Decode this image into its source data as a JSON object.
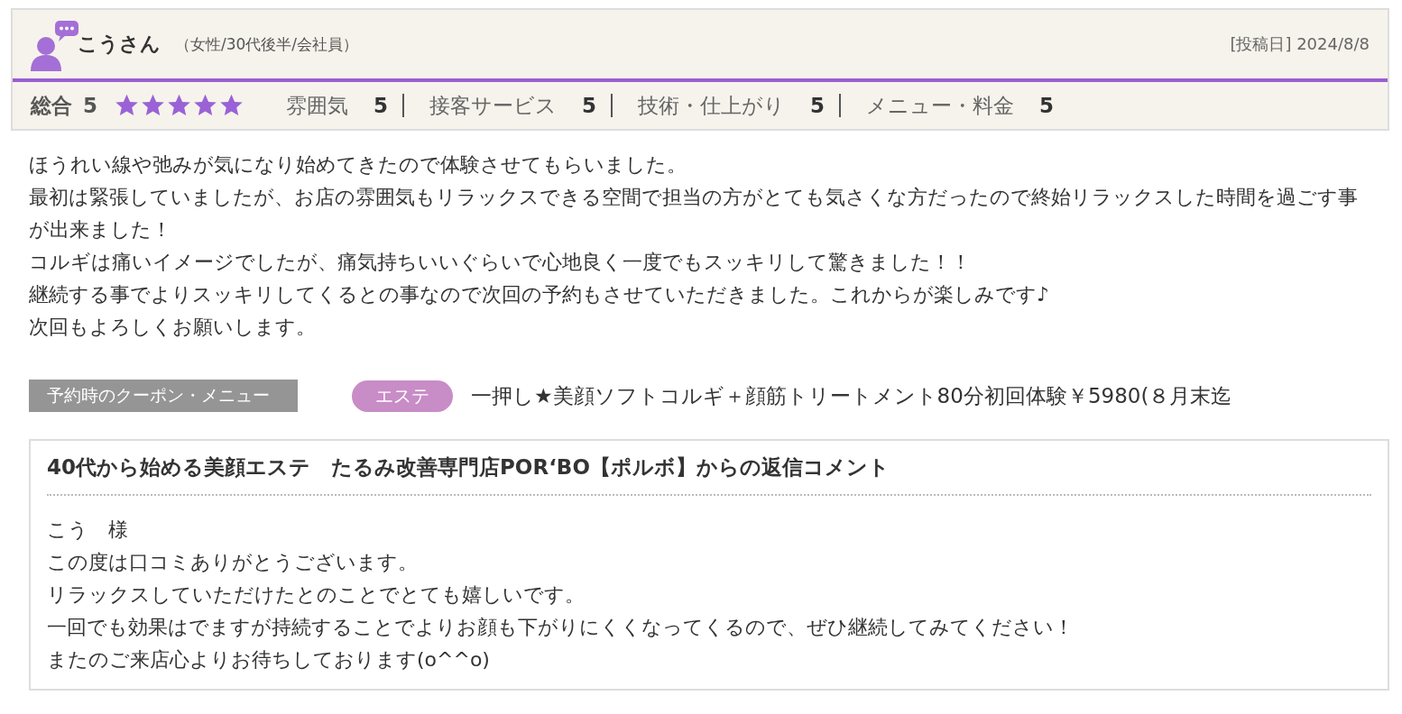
{
  "review": {
    "reviewer": "こうさん",
    "profile": "（女性/30代後半/会社員）",
    "posted": "[投稿日] 2024/8/8",
    "overall": {
      "label": "総合",
      "score": "5",
      "stars": 5
    },
    "categories": [
      {
        "label": "雰囲気",
        "score": "5"
      },
      {
        "label": "接客サービス",
        "score": "5"
      },
      {
        "label": "技術・仕上がり",
        "score": "5"
      },
      {
        "label": "メニュー・料金",
        "score": "5"
      }
    ],
    "body": [
      "ほうれい線や弛みが気になり始めてきたので体験させてもらいました。",
      "最初は緊張していましたが、お店の雰囲気もリラックスできる空間で担当の方がとても気さくな方だったので終始リラックスした時間を過ごす事が出来ました！",
      "コルギは痛いイメージでしたが、痛気持ちいいぐらいで心地良く一度でもスッキリして驚きました！！",
      "継続する事でよりスッキリしてくるとの事なので次回の予約もさせていただきました。これからが楽しみです♪",
      "次回もよろしくお願いします。"
    ],
    "coupon": {
      "label": "予約時のクーポン・メニュー",
      "tag": "エステ",
      "name": "一押し★美顔ソフトコルギ＋顔筋トリートメント80分初回体験￥5980(８月末迄"
    }
  },
  "reply": {
    "title": "40代から始める美顔エステ　たるみ改善専門店POR‘BO【ポルボ】からの返信コメント",
    "body": [
      "こう　様",
      "この度は口コミありがとうございます。",
      "リラックスしていただけたとのことでとても嬉しいです。",
      "一回でも効果はでますが持続することでよりお顔も下がりにくくなってくるので、ぜひ継続してみてください！",
      "またのご来店心よりお待ちしております(o^^o)"
    ]
  }
}
